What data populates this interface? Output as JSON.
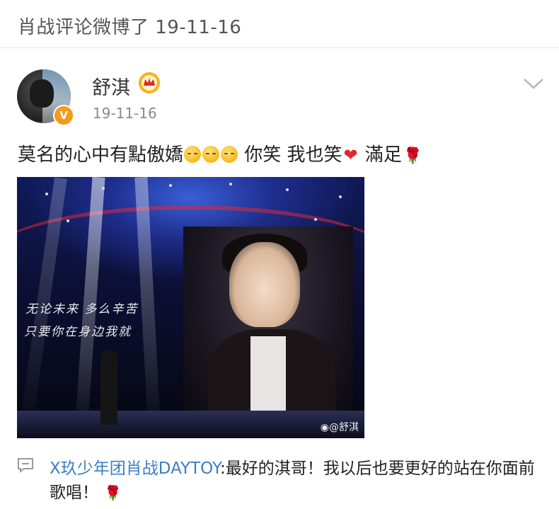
{
  "header": {
    "title": "肖战评论微博了 19-11-16"
  },
  "post": {
    "author": "舒淇",
    "time": "19-11-16",
    "verified_badge": "V",
    "text_parts": {
      "p1": "莫名的心中有點傲嬌",
      "p2": " 你笑 我也笑",
      "p3": " 滿足"
    },
    "image": {
      "lyric_line1": "无论未来 多么辛苦",
      "lyric_line2": "只要你在身边我就",
      "watermark": "@舒淇"
    }
  },
  "comment": {
    "user": "X玖少年团肖战DAYTOY",
    "text": ":最好的淇哥！我以后也要更好的站在你面前歌唱！"
  },
  "colors": {
    "link": "#3b7fc4",
    "badge": "#f49b1c",
    "heart": "#e0282d"
  },
  "icons": [
    "vip-crown-icon",
    "chevron-down-icon",
    "comment-icon",
    "smile-emoji-icon",
    "heart-emoji-icon",
    "rose-emoji-icon",
    "weibo-logo-icon"
  ]
}
